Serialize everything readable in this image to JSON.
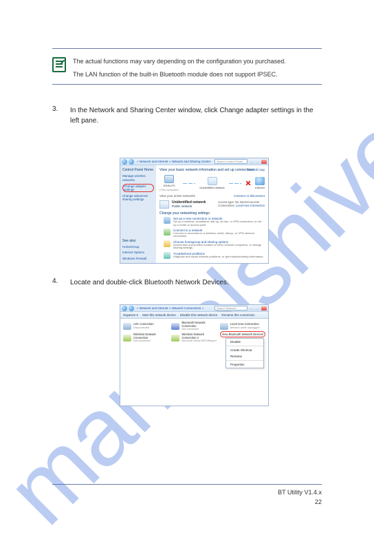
{
  "watermark": "manualshive.com",
  "note": {
    "line1": "The actual functions may vary depending on the configuration you purchased.",
    "line2": "The LAN function of the built-in Bluetooth module does not support IPSEC."
  },
  "step3": {
    "num": "3.",
    "text": "In the Network and Sharing Center window, click Change adapter settings in the left pane."
  },
  "step4": {
    "num": "4.",
    "text": "Locate and double-click Bluetooth Network Devices."
  },
  "screenshot1": {
    "breadcrumb": "« Network and Internet » Network and Sharing Center",
    "search_placeholder": "Search Control Panel",
    "side_header": "Control Panel Home",
    "side_link1": "Manage wireless networks",
    "side_link2_circled": "Change adapter settings",
    "side_link3": "Change advanced sharing settings",
    "side_also": "See also",
    "side_hg": "HomeGroup",
    "side_io": "Internet Options",
    "side_wf": "Windows Firewall",
    "main_title": "View your basic network information and set up connections",
    "see_full_map": "See full map",
    "pc_label": "JOHN-PC",
    "pc_sub": "(This computer)",
    "net_label": "Unidentified network",
    "inet_label": "Internet",
    "view_active": "View your active networks",
    "connect_disconnect": "Connect or disconnect",
    "active_name": "Unidentified network",
    "active_type": "Public network",
    "access_label": "Access type:",
    "access_value": "No Internet access",
    "conn_label": "Connections:",
    "conn_value": "Local Area Connection",
    "change_header": "Change your networking settings",
    "opt1_h": "Set up a new connection or network",
    "opt1_d": "Set up a wireless, broadband, dial-up, ad hoc, or VPN connection; or set up a router or access point.",
    "opt2_h": "Connect to a network",
    "opt2_d": "Connect or reconnect to a wireless, wired, dial-up, or VPN network connection.",
    "opt3_h": "Choose homegroup and sharing options",
    "opt3_d": "Access files and printers located on other network computers, or change sharing settings.",
    "opt4_h": "Troubleshoot problems",
    "opt4_d": "Diagnose and repair network problems, or get troubleshooting information."
  },
  "screenshot2": {
    "breadcrumb": "« Network and Internet » Network Connections »",
    "search_placeholder": "Search Network Connections",
    "menu_organize": "Organize ▾",
    "menu_start": "Start this network device",
    "menu_disable": "Disable this network device",
    "menu_rename": "Rename this connection",
    "conn1_name": "A2C connection",
    "conn1_sub": "Disconnected",
    "conn2_name": "Bluetooth Network Connection",
    "conn2_sub": "Not connected",
    "conn3_name": "Local Area Connection",
    "conn3_sub": "Network cable unplugged",
    "conn4_name": "Wireless Network Connection",
    "conn4_sub": "Not connected",
    "conn5_name": "Wireless Network Connection 2",
    "conn5_sub": "Microsoft Virtual WiFi Miniport",
    "highlight": "View Bluetooth Network Devices",
    "ctx_disable": "Disable",
    "ctx_short": "Create Shortcut",
    "ctx_rename": "Rename",
    "ctx_props": "Properties"
  },
  "footer": {
    "label": "BT Utility V1.4.x",
    "page": "22"
  }
}
